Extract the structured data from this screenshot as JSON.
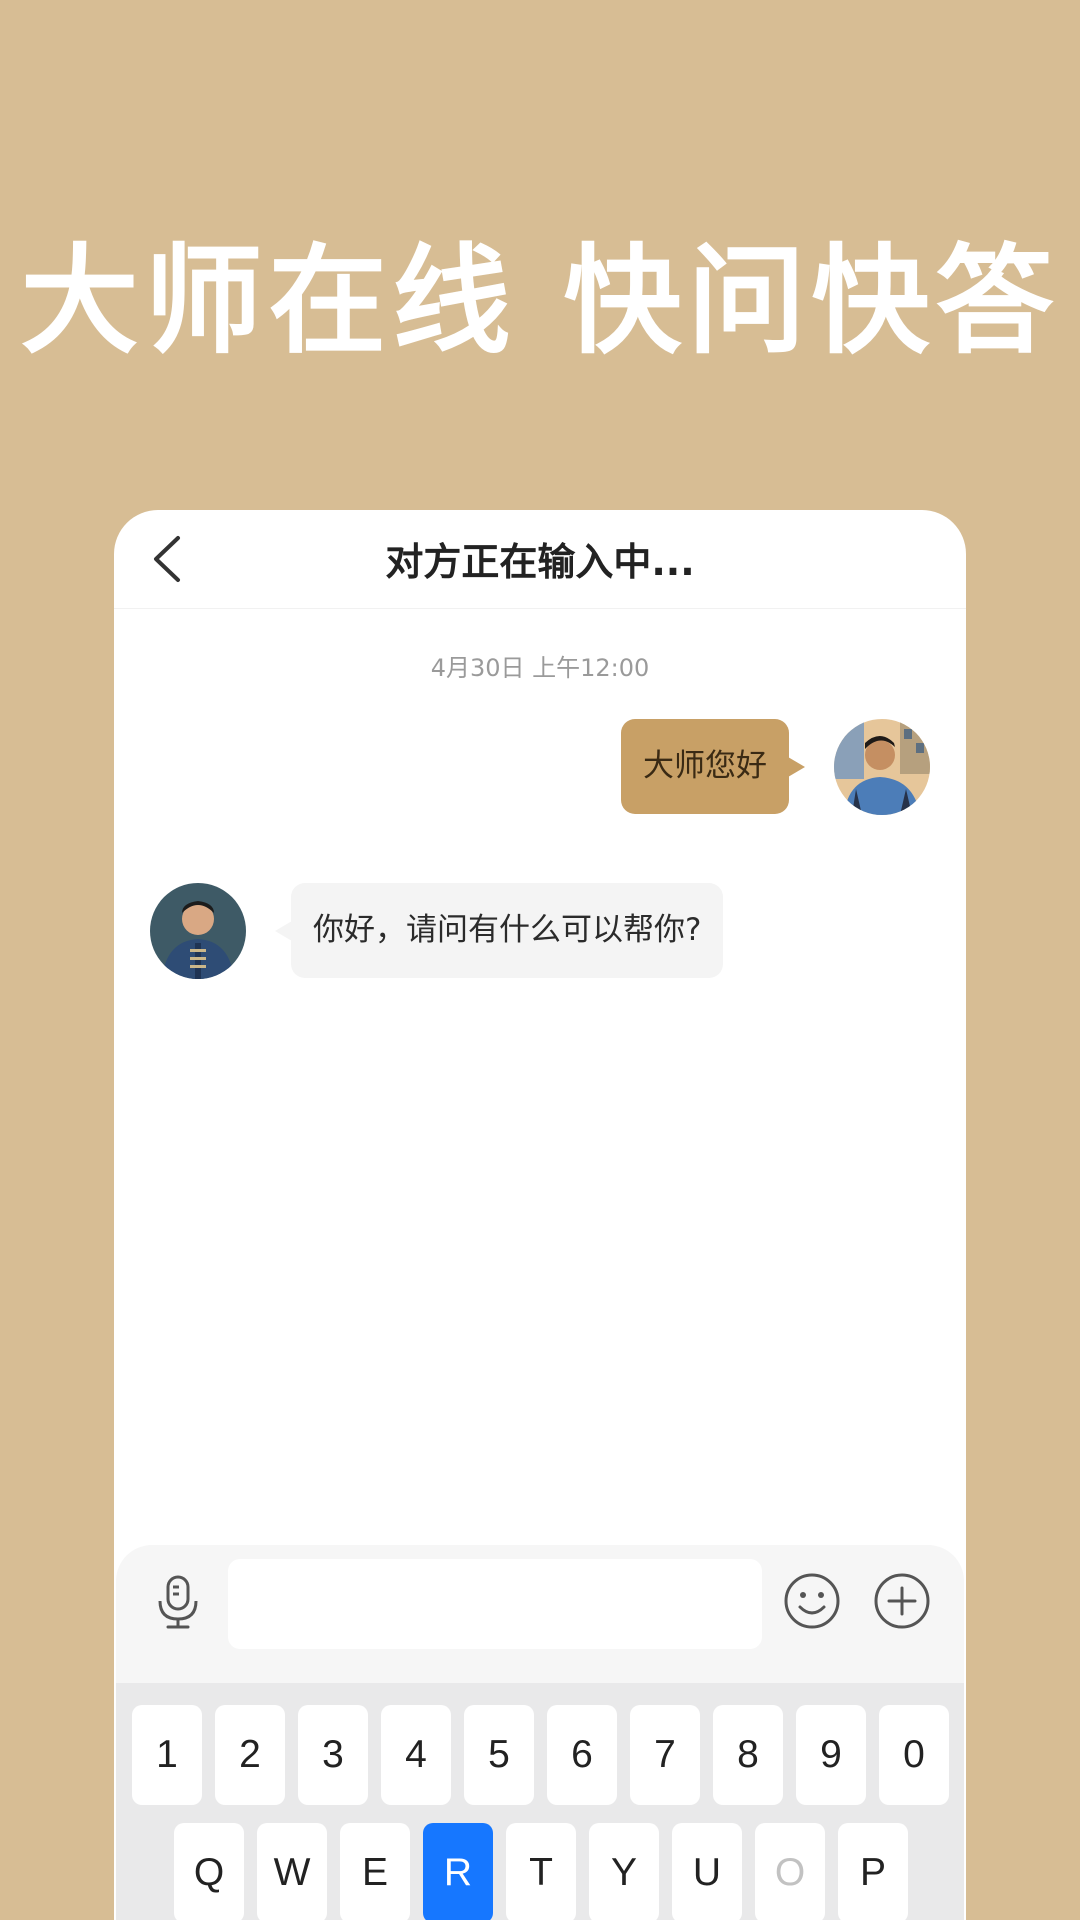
{
  "headline": "大师在线 快问快答",
  "chat": {
    "title": "对方正在输入中...",
    "timestamp": "4月30日 上午12:00",
    "messages": [
      {
        "from": "user",
        "text": "大师您好"
      },
      {
        "from": "master",
        "text": "你好，请问有什么可以帮你?"
      }
    ]
  },
  "input": {
    "value": "",
    "placeholder": "",
    "icons": [
      "microphone-icon",
      "emoji-icon",
      "plus-circle-icon"
    ]
  },
  "keyboard": {
    "number_row": [
      "1",
      "2",
      "3",
      "4",
      "5",
      "6",
      "7",
      "8",
      "9",
      "0"
    ],
    "letter_row": [
      "Q",
      "W",
      "E",
      "R",
      "T",
      "Y",
      "U",
      "O",
      "P"
    ],
    "active_key": "R",
    "faded_key": "O"
  },
  "colors": {
    "background": "#d7bd94",
    "outgoing_bubble": "#c8a066",
    "incoming_bubble": "#f4f4f4",
    "active_key": "#1677ff"
  }
}
